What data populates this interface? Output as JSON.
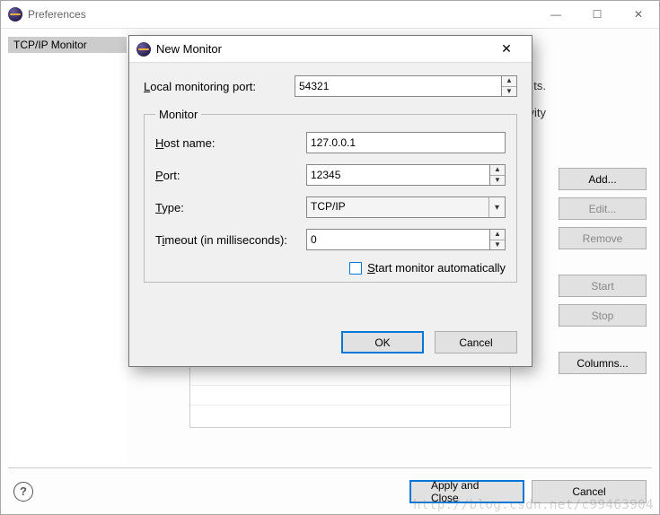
{
  "prefs": {
    "title": "Preferences",
    "tree_selected": "TCP/IP Monitor",
    "hints_line1": "ts.",
    "hints_line2": "vity",
    "side_buttons": {
      "add": "Add...",
      "edit": "Edit...",
      "remove": "Remove",
      "start": "Start",
      "stop": "Stop",
      "columns": "Columns..."
    },
    "bottom": {
      "apply_close": "Apply and Close",
      "cancel": "Cancel"
    }
  },
  "modal": {
    "title": "New Monitor",
    "local_port_label_pre": "L",
    "local_port_label_post": "ocal monitoring port:",
    "local_port_value": "54321",
    "group_label": "Monitor",
    "host_label_pre": "H",
    "host_label_post": "ost name:",
    "host_value": "127.0.0.1",
    "port_label_pre": "P",
    "port_label_post": "ort:",
    "port_value": "12345",
    "type_label_pre": "T",
    "type_label_post": "ype:",
    "type_value": "TCP/IP",
    "timeout_label_pre": "T",
    "timeout_label_post": "imeout (in milliseconds):",
    "timeout_value": "0",
    "auto_label_pre": "S",
    "auto_label_post": "tart monitor automatically",
    "auto_checked": false,
    "ok": "OK",
    "cancel": "Cancel"
  },
  "watermark": "http://blog.csdn.net/c99463904"
}
